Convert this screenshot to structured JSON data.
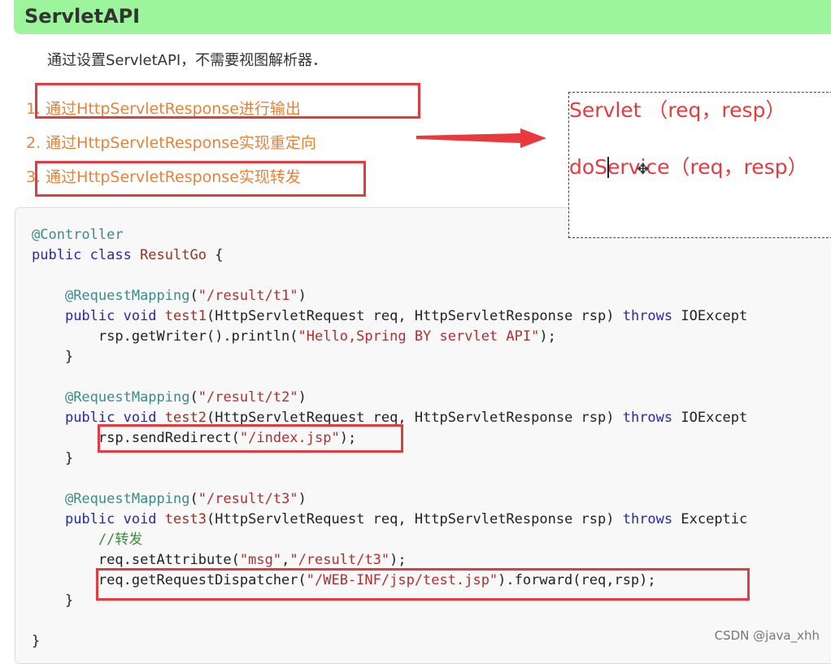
{
  "header": {
    "title": "ServletAPI"
  },
  "intro": "通过设置ServletAPI，不需要视图解析器．",
  "steps": [
    "1. 通过HttpServletResponse进行输出",
    "2. 通过HttpServletResponse实现重定向",
    "3. 通过HttpServletResponse实现转发"
  ],
  "note": {
    "line1": "Servlet （req，resp）",
    "line2": "doService（req，resp）"
  },
  "code": {
    "l1": "@Controller",
    "l2a": "public class ",
    "l2b": "ResultGo",
    "l2c": " {",
    "ann": "@RequestMapping",
    "t1path": "\"/result/t1\"",
    "t2path": "\"/result/t2\"",
    "t3path": "\"/result/t3\"",
    "pubvoid": "public void ",
    "test1": "test1",
    "test2": "test2",
    "test3": "test3",
    "params": "(HttpServletRequest req, HttpServletResponse rsp) ",
    "throws": "throws",
    "ioex": " IOExcept",
    "exc": " Exceptic",
    "w1": "rsp.getWriter().println(",
    "hello": "\"Hello,Spring BY servlet API\"",
    "w1end": ");",
    "redir1": "rsp.sendRedirect(",
    "indexjsp": "\"/index.jsp\"",
    "redir2": ");",
    "comment": "//转发",
    "set1": "req.setAttribute(",
    "msg": "\"msg\"",
    "comma": ",",
    "t3s": "\"/result/t3\"",
    "set2": ");",
    "disp1": "req.getRequestDispatcher(",
    "testjsp": "\"/WEB-INF/jsp/test.jsp\"",
    "disp2": ").forward(req,rsp);",
    "brace": "}"
  },
  "watermark": "CSDN @java_xhh",
  "colors": {
    "header_bg": "#9cf59c",
    "step_text": "#e8823a",
    "highlight": "#e8393f"
  }
}
